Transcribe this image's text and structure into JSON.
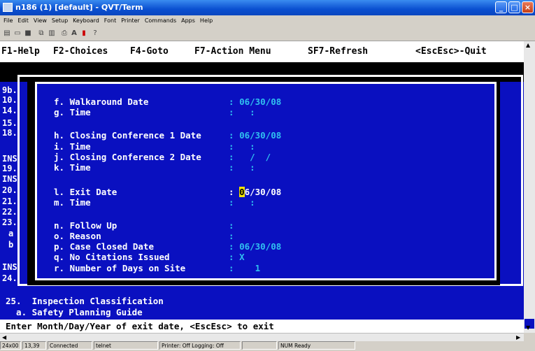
{
  "window": {
    "title": "n186 (1) [default] - QVT/Term"
  },
  "menu": [
    "File",
    "Edit",
    "View",
    "Setup",
    "Keyboard",
    "Font",
    "Printer",
    "Commands",
    "Apps",
    "Help"
  ],
  "fkeys": [
    "F1-Help",
    "F2-Choices",
    "F4-Goto",
    "F7-Action Menu",
    "SF7-Refresh",
    "<EscEsc>-Quit"
  ],
  "left_column": [
    "9b.",
    "10.",
    "14.",
    "15.",
    "18.",
    "",
    "INS",
    "19.",
    "INS",
    "20.",
    "21.",
    "22.",
    "23.",
    "a",
    "b",
    "",
    "INS",
    "24."
  ],
  "fields": [
    {
      "label": "f. Walkaround Date",
      "value": "06/30/08"
    },
    {
      "label": "g. Time",
      "value": ":"
    },
    {
      "label": "h. Closing Conference 1 Date",
      "value": "06/30/08"
    },
    {
      "label": "i. Time",
      "value": ":"
    },
    {
      "label": "j. Closing Conference 2 Date",
      "value": "/  /"
    },
    {
      "label": "k. Time",
      "value": ":"
    },
    {
      "label": "l. Exit Date",
      "value_cursor": "0",
      "value_rest": "6/30/08"
    },
    {
      "label": "m. Time",
      "value": ":"
    },
    {
      "label": "n. Follow Up",
      "value": ""
    },
    {
      "label": "o. Reason",
      "value": ""
    },
    {
      "label": "p. Case Closed Date",
      "value": "06/30/08"
    },
    {
      "label": "q. No Citations Issued",
      "value": "X"
    },
    {
      "label": "r. Number of Days on Site",
      "value": "1"
    }
  ],
  "bottom_lines": [
    "25.  Inspection Classification",
    "  a. Safety Planning Guide"
  ],
  "status_line": "Enter Month/Day/Year of exit date, <EscEsc> to exit",
  "statusbar": [
    "24x00",
    "13,39",
    "Connected",
    "telnet",
    "Printer: Off  Logging: Off",
    "",
    "NUM  Ready"
  ]
}
